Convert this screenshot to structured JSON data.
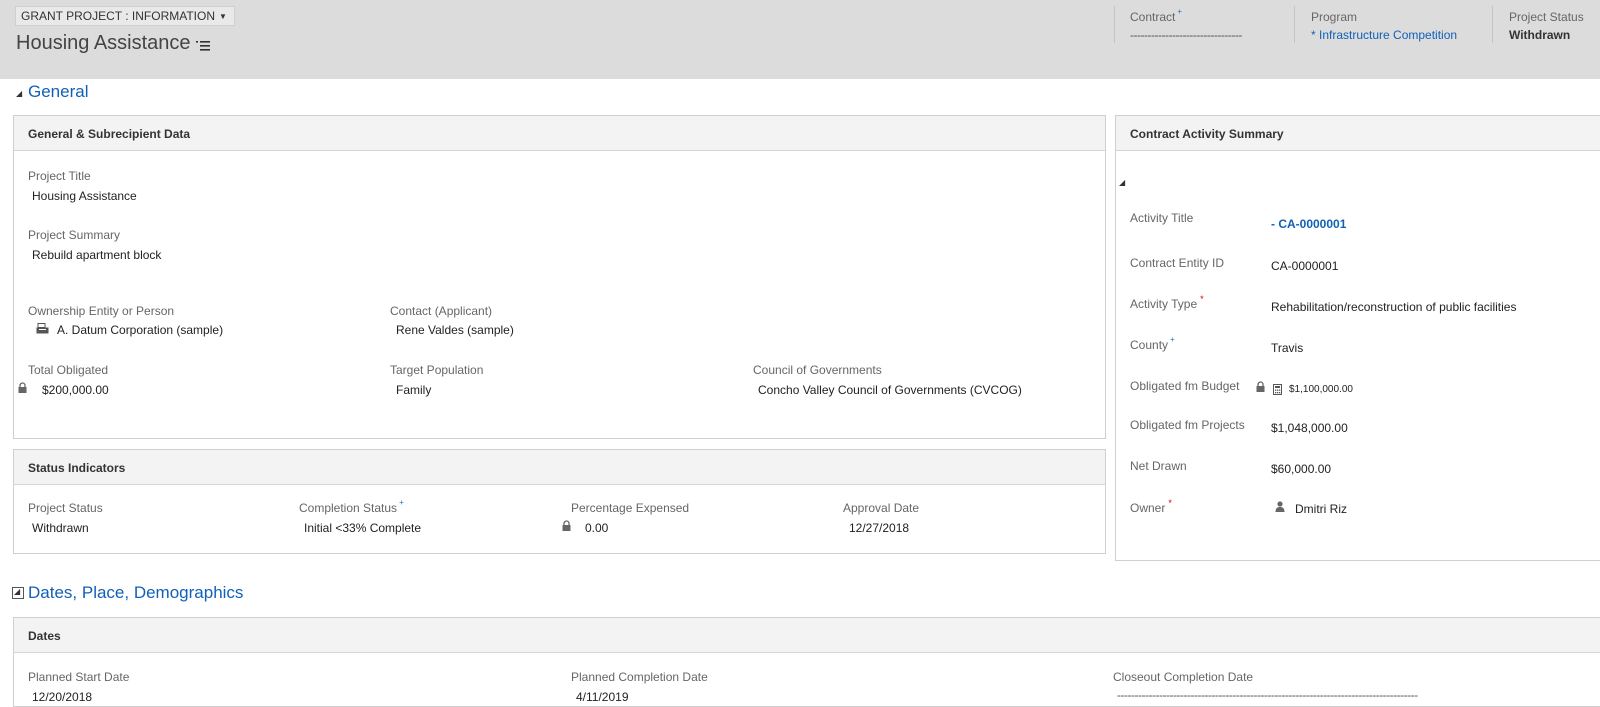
{
  "header": {
    "form_selector": "GRANT PROJECT : INFORMATION",
    "title": "Housing Assistance",
    "fields": {
      "contract": {
        "label": "Contract",
        "value": "--------------------------------"
      },
      "program": {
        "label": "Program",
        "value": "* Infrastructure Competition"
      },
      "project_status": {
        "label": "Project Status",
        "value": "Withdrawn"
      }
    }
  },
  "sections": {
    "general": "General",
    "dates_place": "Dates, Place, Demographics"
  },
  "general_panel": {
    "title": "General & Subrecipient Data",
    "project_title": {
      "label": "Project Title",
      "value": "Housing Assistance"
    },
    "project_summary": {
      "label": "Project Summary",
      "value": "Rebuild apartment block"
    },
    "ownership": {
      "label": "Ownership Entity or Person",
      "value": "A. Datum Corporation (sample)"
    },
    "contact": {
      "label": "Contact (Applicant)",
      "value": "Rene Valdes (sample)"
    },
    "total_obligated": {
      "label": "Total Obligated",
      "value": "$200,000.00"
    },
    "target_population": {
      "label": "Target Population",
      "value": "Family"
    },
    "council": {
      "label": "Council of Governments",
      "value": "Concho Valley Council of Governments (CVCOG)"
    }
  },
  "status_panel": {
    "title": "Status Indicators",
    "project_status": {
      "label": "Project Status",
      "value": "Withdrawn"
    },
    "completion_status": {
      "label": "Completion Status",
      "value": "Initial <33% Complete"
    },
    "percentage_expensed": {
      "label": "Percentage Expensed",
      "value": "0.00"
    },
    "approval_date": {
      "label": "Approval Date",
      "value": "12/27/2018"
    }
  },
  "contract_panel": {
    "title": "Contract Activity Summary",
    "activity_title": {
      "label": "Activity Title",
      "value": "- CA-0000001"
    },
    "contract_entity_id": {
      "label": "Contract Entity ID",
      "value": "CA-0000001"
    },
    "activity_type": {
      "label": "Activity Type",
      "value": "Rehabilitation/reconstruction of public facilities"
    },
    "county": {
      "label": "County",
      "value": "Travis"
    },
    "obligated_budget": {
      "label": "Obligated fm Budget",
      "value": "$1,100,000.00"
    },
    "obligated_projects": {
      "label": "Obligated fm Projects",
      "value": "$1,048,000.00"
    },
    "net_drawn": {
      "label": "Net Drawn",
      "value": "$60,000.00"
    },
    "owner": {
      "label": "Owner",
      "value": "Dmitri Riz"
    }
  },
  "dates_panel": {
    "title": "Dates",
    "planned_start": {
      "label": "Planned Start Date",
      "value": "12/20/2018"
    },
    "planned_completion": {
      "label": "Planned Completion Date",
      "value": "4/11/2019"
    },
    "closeout_completion": {
      "label": "Closeout Completion Date",
      "value": "--------------------------------------------------------------------------------------"
    }
  }
}
